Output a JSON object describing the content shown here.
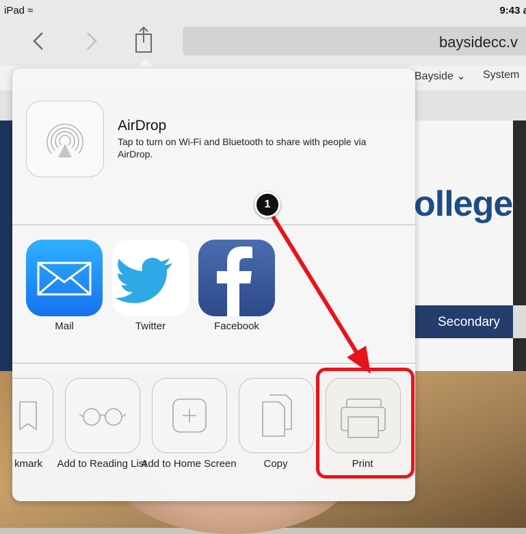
{
  "status_bar": {
    "device": "iPad",
    "time": "9:43 a"
  },
  "toolbar": {
    "url": "baysidecc.v",
    "back_icon": "chevron-left-icon",
    "forward_icon": "chevron-right-icon",
    "share_icon": "share-icon"
  },
  "webpage": {
    "tabs": [
      "Bayside ⌄",
      "System"
    ],
    "brand_text": "ollege",
    "nav_item": "Secondary"
  },
  "share_sheet": {
    "airdrop": {
      "title": "AirDrop",
      "description": "Tap to turn on Wi-Fi and Bluetooth to share with people via AirDrop."
    },
    "apps": [
      {
        "label": "Mail",
        "icon": "mail-icon",
        "color": "#1a8cf5"
      },
      {
        "label": "Twitter",
        "icon": "twitter-bird-icon",
        "color": "#2aa9e0"
      },
      {
        "label": "Facebook",
        "icon": "facebook-icon",
        "color": "#3b5998"
      }
    ],
    "actions": [
      {
        "label": "kmark",
        "icon": "bookmark-icon"
      },
      {
        "label": "Add to Reading List",
        "icon": "glasses-icon"
      },
      {
        "label": "Add to Home Screen",
        "icon": "plus-icon"
      },
      {
        "label": "Copy",
        "icon": "copy-icon"
      },
      {
        "label": "Print",
        "icon": "printer-icon"
      }
    ]
  },
  "annotation": {
    "step_number": "1",
    "highlight_color": "#e8141b"
  }
}
